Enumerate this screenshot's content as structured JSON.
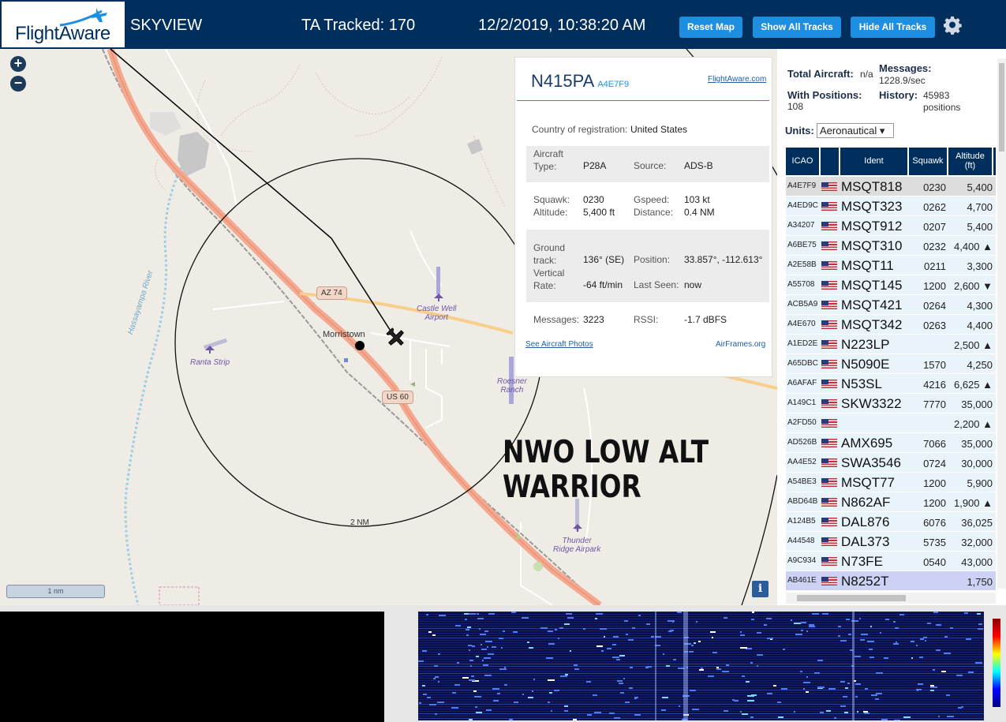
{
  "header": {
    "logo_text": "FlightAware",
    "app_name": "SKYVIEW",
    "tracked": "TA Tracked: 170",
    "datetime": "12/2/2019, 10:38:20 AM",
    "reset_map": "Reset Map",
    "show_all": "Show All Tracks",
    "hide_all": "Hide All Tracks"
  },
  "map": {
    "zoom_in": "+",
    "zoom_out": "−",
    "scale": "1 nm",
    "range_label": "2 NM",
    "info": "i",
    "labels": {
      "morristown": "Morristown",
      "az74": "AZ 74",
      "us60": "US 60",
      "river": "Hassayampa River",
      "castle_well": "Castle Well\nAirport",
      "ranta": "Ranta Strip",
      "roesner": "Roesner\nRanch",
      "thunder": "Thunder\nRidge Airpark"
    },
    "overlay_text": [
      "NWO LOW ALT",
      "WARRIOR"
    ]
  },
  "popup": {
    "callsign": "N415PA",
    "hex": "A4E7F9",
    "fa_link": "FlightAware.com",
    "country_label": "Country of registration:",
    "country": "United States",
    "aircraft_type_label": "Aircraft\nType:",
    "aircraft_type": "P28A",
    "source_label": "Source:",
    "source": "ADS-B",
    "squawk_label": "Squawk:",
    "squawk": "0230",
    "gspeed_label": "Gspeed:",
    "gspeed": "103 kt",
    "altitude_label": "Altitude:",
    "altitude": "5,400 ft",
    "distance_label": "Distance:",
    "distance": "0.4 NM",
    "track_label": "Ground\ntrack:",
    "track": "136° (SE)",
    "position_label": "Position:",
    "position": "33.857°, -112.613°",
    "vrate_label": "Vertical\nRate:",
    "vrate": "-64 ft/min",
    "lastseen_label": "Last Seen:",
    "lastseen": "now",
    "messages_label": "Messages:",
    "messages": "3223",
    "rssi_label": "RSSI:",
    "rssi": "-1.7 dBFS",
    "photos_link": "See Aircraft Photos",
    "airframes_link": "AirFrames.org"
  },
  "sidebar": {
    "total_label": "Total Aircraft:",
    "total": "n/a",
    "messages_label": "Messages:",
    "messages": "1228.9/sec",
    "positions_label": "With Positions:",
    "positions": "108",
    "history_label": "History:",
    "history": "45983\npositions",
    "units_label": "Units:",
    "units": "Aeronautical ▾",
    "columns": [
      "ICAO",
      "",
      "Ident",
      "Squawk",
      "Altitude\n(ft)"
    ],
    "rows": [
      {
        "icao": "A4E7F9",
        "ident": "MSQT818",
        "squawk": "0230",
        "alt": "5,400"
      },
      {
        "icao": "A4ED9C",
        "ident": "MSQT323",
        "squawk": "0262",
        "alt": "4,700"
      },
      {
        "icao": "A34207",
        "ident": "MSQT912",
        "squawk": "0207",
        "alt": "5,400"
      },
      {
        "icao": "A6BE75",
        "ident": "MSQT310",
        "squawk": "0232",
        "alt": "4,400 ▲"
      },
      {
        "icao": "A2E58B",
        "ident": "MSQT11",
        "squawk": "0211",
        "alt": "3,300"
      },
      {
        "icao": "A55708",
        "ident": "MSQT145",
        "squawk": "1200",
        "alt": "2,600 ▼"
      },
      {
        "icao": "ACB5A9",
        "ident": "MSQT421",
        "squawk": "0264",
        "alt": "4,300"
      },
      {
        "icao": "A4E670",
        "ident": "MSQT342",
        "squawk": "0263",
        "alt": "4,400"
      },
      {
        "icao": "A1ED2E",
        "ident": "N223LP",
        "squawk": "",
        "alt": "2,500 ▲"
      },
      {
        "icao": "A65DBC",
        "ident": "N5090E",
        "squawk": "1570",
        "alt": "4,250"
      },
      {
        "icao": "A6AFAF",
        "ident": "N53SL",
        "squawk": "4216",
        "alt": "6,625 ▲"
      },
      {
        "icao": "A149C1",
        "ident": "SKW3322",
        "squawk": "7770",
        "alt": "35,000"
      },
      {
        "icao": "A2FD50",
        "ident": "",
        "squawk": "",
        "alt": "2,200 ▲"
      },
      {
        "icao": "AD526B",
        "ident": "AMX695",
        "squawk": "7066",
        "alt": "35,000"
      },
      {
        "icao": "AA4E52",
        "ident": "SWA3546",
        "squawk": "0724",
        "alt": "30,000"
      },
      {
        "icao": "A54BE3",
        "ident": "MSQT77",
        "squawk": "1200",
        "alt": "5,900"
      },
      {
        "icao": "ABD64B",
        "ident": "N862AF",
        "squawk": "1200",
        "alt": "1,900 ▲"
      },
      {
        "icao": "A124B5",
        "ident": "DAL876",
        "squawk": "6076",
        "alt": "36,025"
      },
      {
        "icao": "A44548",
        "ident": "DAL373",
        "squawk": "5735",
        "alt": "32,000"
      },
      {
        "icao": "A9C934",
        "ident": "N73FE",
        "squawk": "0540",
        "alt": "43,000"
      },
      {
        "icao": "AB461E",
        "ident": "N8252T",
        "squawk": "",
        "alt": "1,750"
      }
    ]
  },
  "colors": {
    "header_bg": "#002f5d",
    "button_bg": "#1e8fe0",
    "highway": "#f4a88e",
    "range_ring": "#111111"
  }
}
